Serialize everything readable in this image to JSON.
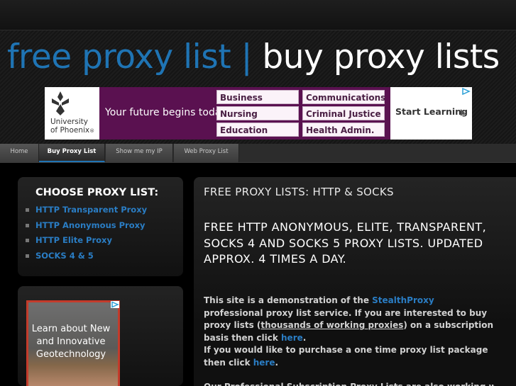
{
  "header": {
    "title_part1": "free proxy list",
    "title_sep": " | ",
    "title_part2": "buy proxy lists"
  },
  "ad_banner": {
    "logo_line1": "University",
    "logo_line2": "of Phoenix",
    "logo_mark": "®",
    "tagline": "Your future begins today.",
    "options": [
      "Business",
      "Communications",
      "Nursing",
      "Criminal Justice",
      "Education",
      "Health Admin."
    ],
    "cta": "Start Learning",
    "brand_color": "#5a1150"
  },
  "nav": {
    "items": [
      {
        "label": "Home"
      },
      {
        "label": "Buy Proxy List",
        "active": true
      },
      {
        "label": "Show me my IP"
      },
      {
        "label": "Web Proxy List"
      }
    ]
  },
  "sidebar": {
    "title": "CHOOSE PROXY LIST:",
    "items": [
      "HTTP Transparent Proxy",
      "HTTP Anonymous Proxy",
      "HTTP Elite Proxy",
      "SOCKS 4 & 5"
    ]
  },
  "side_ad": {
    "text": "Learn about New and Innovative Geotechnology"
  },
  "main": {
    "title": "FREE PROXY LISTS: HTTP & SOCKS",
    "subtitle": "FREE HTTP ANONYMOUS, ELITE, TRANSPARENT, SOCKS 4 AND SOCKS 5 PROXY LISTS. UPDATED APPROX. 4 TIMES A DAY.",
    "p1_a": "This site is a demonstration of the ",
    "p1_link": "StealthProxy",
    "p1_b": " professional proxy list service. If you are interested to buy proxy lists (",
    "p1_ulink": "thousands of working proxies",
    "p1_c": ") on a subscription basis then click ",
    "p1_here": "here",
    "p1_d": ".",
    "p2_a": "If you would like to purchase a one time proxy list package then click ",
    "p2_here": "here",
    "p2_b": ".",
    "p3": "Our Professional Subscription Proxy Lists are also working with"
  },
  "colors": {
    "accent": "#1f74b4",
    "link": "#2a7dc4",
    "background": "#000000"
  }
}
